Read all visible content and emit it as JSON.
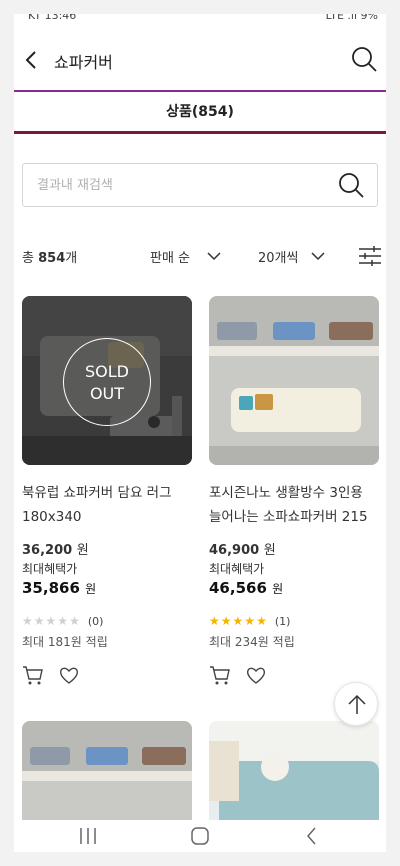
{
  "status_bar": {
    "carrier": "KT 13:46",
    "indicators": "LTE .ıl 9%"
  },
  "header": {
    "title": "쇼파커버",
    "back_icon": "chevron-left-icon",
    "search_icon": "search-icon"
  },
  "tab": {
    "label": "상품(854)",
    "accent_color": "#8a2a91",
    "underline_color": "#7c1838"
  },
  "search": {
    "placeholder": "결과내 재검색",
    "value": ""
  },
  "filter_bar": {
    "count_prefix": "총",
    "count_value": "854",
    "count_suffix": "개",
    "sort_label": "판매 순",
    "page_size_label": "20개씩",
    "filter_icon": "sliders-icon"
  },
  "products": [
    {
      "name_line1": "북유럽 쇼파커버 담요 러그",
      "name_line2": "180x340",
      "price": "36,200",
      "price_unit": "원",
      "benefit_label": "최대혜택가",
      "benefit_price": "35,866",
      "benefit_unit": "원",
      "stars": 0,
      "review_count": "(0)",
      "points": "최대 181원 적립",
      "sold_out": true,
      "sold_out_line1": "SOLD",
      "sold_out_line2": "OUT"
    },
    {
      "name_line1": "포시즌나노 생활방수 3인용",
      "name_line2": "늘어나는 소파쇼파커버 215",
      "price": "46,900",
      "price_unit": "원",
      "benefit_label": "최대혜택가",
      "benefit_price": "46,566",
      "benefit_unit": "원",
      "stars": 5,
      "review_count": "(1)",
      "points": "최대 234원 적립",
      "sold_out": false
    }
  ],
  "colors": {
    "star_filled": "#f5b400",
    "star_empty": "#d0d0d0"
  }
}
